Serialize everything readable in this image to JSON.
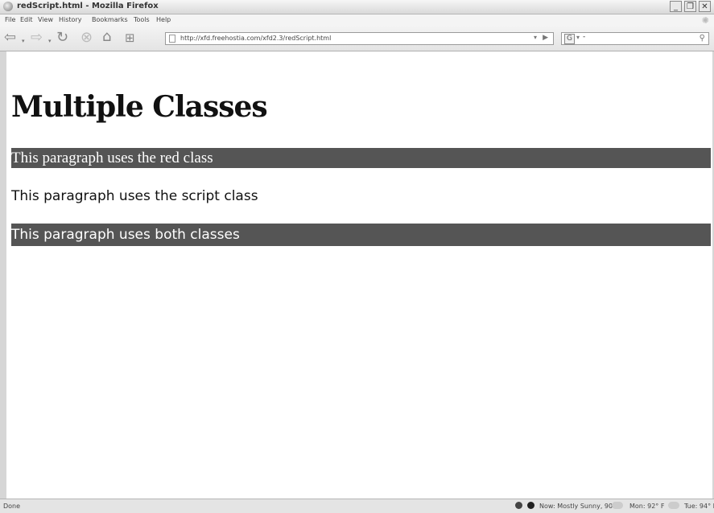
{
  "window": {
    "title": "redScript.html - Mozilla Firefox",
    "minimize": "_",
    "maximize": "❐",
    "close": "✕"
  },
  "menus": [
    "File",
    "Edit",
    "View",
    "History",
    "Bookmarks",
    "Tools",
    "Help"
  ],
  "nav": {
    "url": "http://xfd.freehostia.com/xfd2.3/redScript.html",
    "search_value": "-",
    "search_engine_icon": "G"
  },
  "page": {
    "heading": "Multiple Classes",
    "para_red": "This paragraph uses the red class",
    "para_script": "This paragraph uses the script class",
    "para_both": "This paragraph uses both classes",
    "highlight_bg": "#555555"
  },
  "status": {
    "text": "Done",
    "weather_now": "Now: Mostly Sunny, 90° F",
    "weather_mon": "Mon: 92° F",
    "weather_tue": "Tue: 94° F"
  }
}
